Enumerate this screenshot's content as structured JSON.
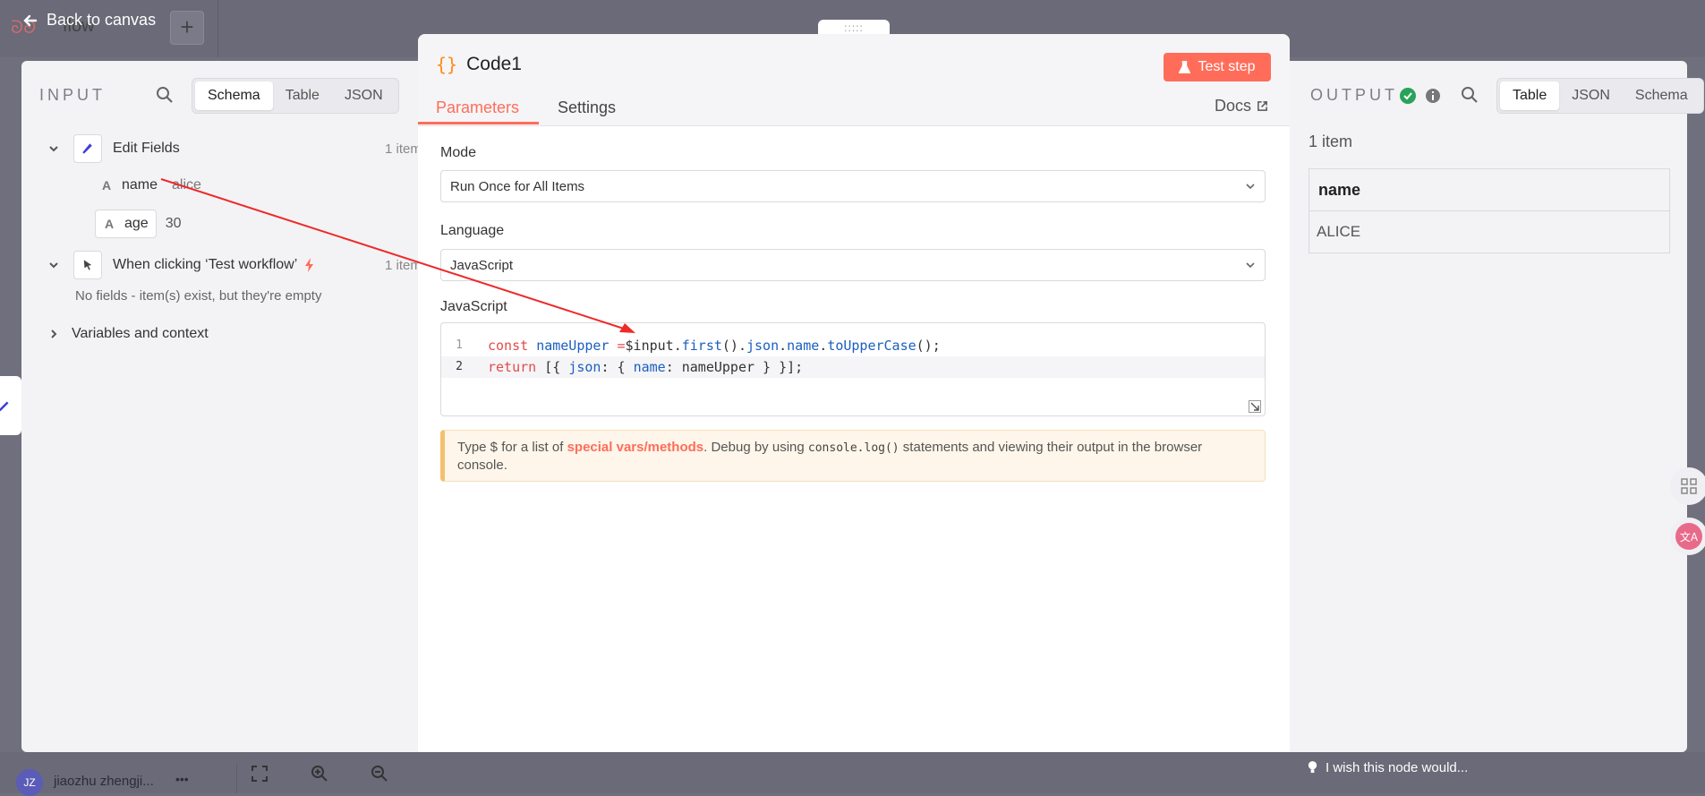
{
  "top": {
    "back_label": "Back to canvas",
    "workflow_partial": "flow"
  },
  "input_panel": {
    "title": "INPUT",
    "tabs": [
      "Schema",
      "Table",
      "JSON"
    ],
    "active_tab": "Schema",
    "nodes": [
      {
        "name": "Edit Fields",
        "count": "1 item",
        "fields": [
          {
            "type": "A",
            "name": "name",
            "value": "alice"
          },
          {
            "type": "A",
            "name": "age",
            "value": "30"
          }
        ]
      },
      {
        "name": "When clicking ‘Test workflow’",
        "count": "1 item",
        "empty_note": "No fields - item(s) exist, but they're empty"
      }
    ],
    "variables_label": "Variables and context"
  },
  "modal": {
    "handle": ":::::",
    "node_title": "Code1",
    "test_button": "Test step",
    "tabs": [
      "Parameters",
      "Settings"
    ],
    "active_tab": "Parameters",
    "docs_label": "Docs",
    "mode_label": "Mode",
    "mode_value": "Run Once for All Items",
    "language_label": "Language",
    "language_value": "JavaScript",
    "code_label": "JavaScript",
    "code_lines": [
      {
        "n": "1",
        "text": "const nameUpper =$input.first().json.name.toUpperCase();"
      },
      {
        "n": "2",
        "text": "return [{ json: { name: nameUpper } }];"
      }
    ],
    "hint": {
      "prefix": "Type $ for a list of ",
      "link": "special vars/methods",
      "middle": ". Debug by using ",
      "code": "console.log()",
      "suffix": " statements and viewing their output in the browser console."
    }
  },
  "output_panel": {
    "title": "OUTPUT",
    "tabs": [
      "Table",
      "JSON",
      "Schema"
    ],
    "active_tab": "Table",
    "count": "1 item",
    "table": {
      "header": "name",
      "rows": [
        "ALICE"
      ]
    }
  },
  "bottom": {
    "avatar": "JZ",
    "user": "jiaozhu zhengji...",
    "menu": "•••",
    "wish": "I wish this node would..."
  },
  "colors": {
    "accent": "#ff6d5a",
    "success": "#29a35a"
  }
}
